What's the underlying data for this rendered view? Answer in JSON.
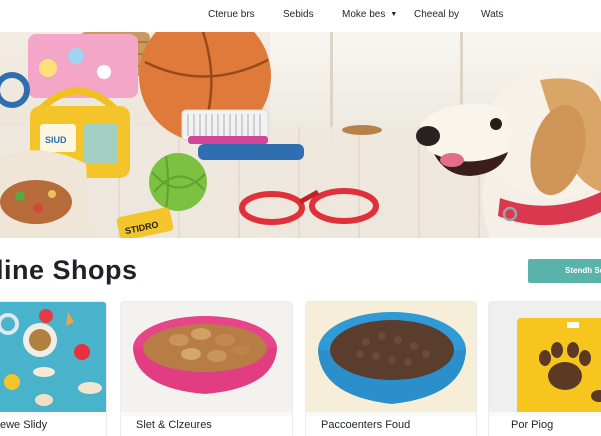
{
  "nav": {
    "items": [
      {
        "label": "Cterue brs"
      },
      {
        "label": "Sebids"
      },
      {
        "label": "Moke bes",
        "has_dropdown": true
      },
      {
        "label": "Cheeal by"
      },
      {
        "label": "Wats"
      }
    ]
  },
  "hero": {
    "toy_label": "STIDRO",
    "basket_label": "SIUD",
    "colors": {
      "dog_collar": "#d9394f",
      "ball": "#e07a3a",
      "yarn": "#7cc142",
      "accent_blue": "#2f6fb0"
    }
  },
  "section": {
    "title": "line Shops",
    "cta_label": "Stendh Se"
  },
  "cards": [
    {
      "name": "ewe Slidy",
      "image": "toys-on-blue-icon"
    },
    {
      "name": "Slet & Clzeures",
      "image": "pink-treat-bowl-icon"
    },
    {
      "name": "Paccoenters Foud",
      "image": "blue-kibble-bowl-icon"
    },
    {
      "name": "Por Piog",
      "image": "yellow-paw-bag-icon"
    }
  ],
  "colors": {
    "cta": "#5ab3aa",
    "heading": "#1c2227"
  }
}
